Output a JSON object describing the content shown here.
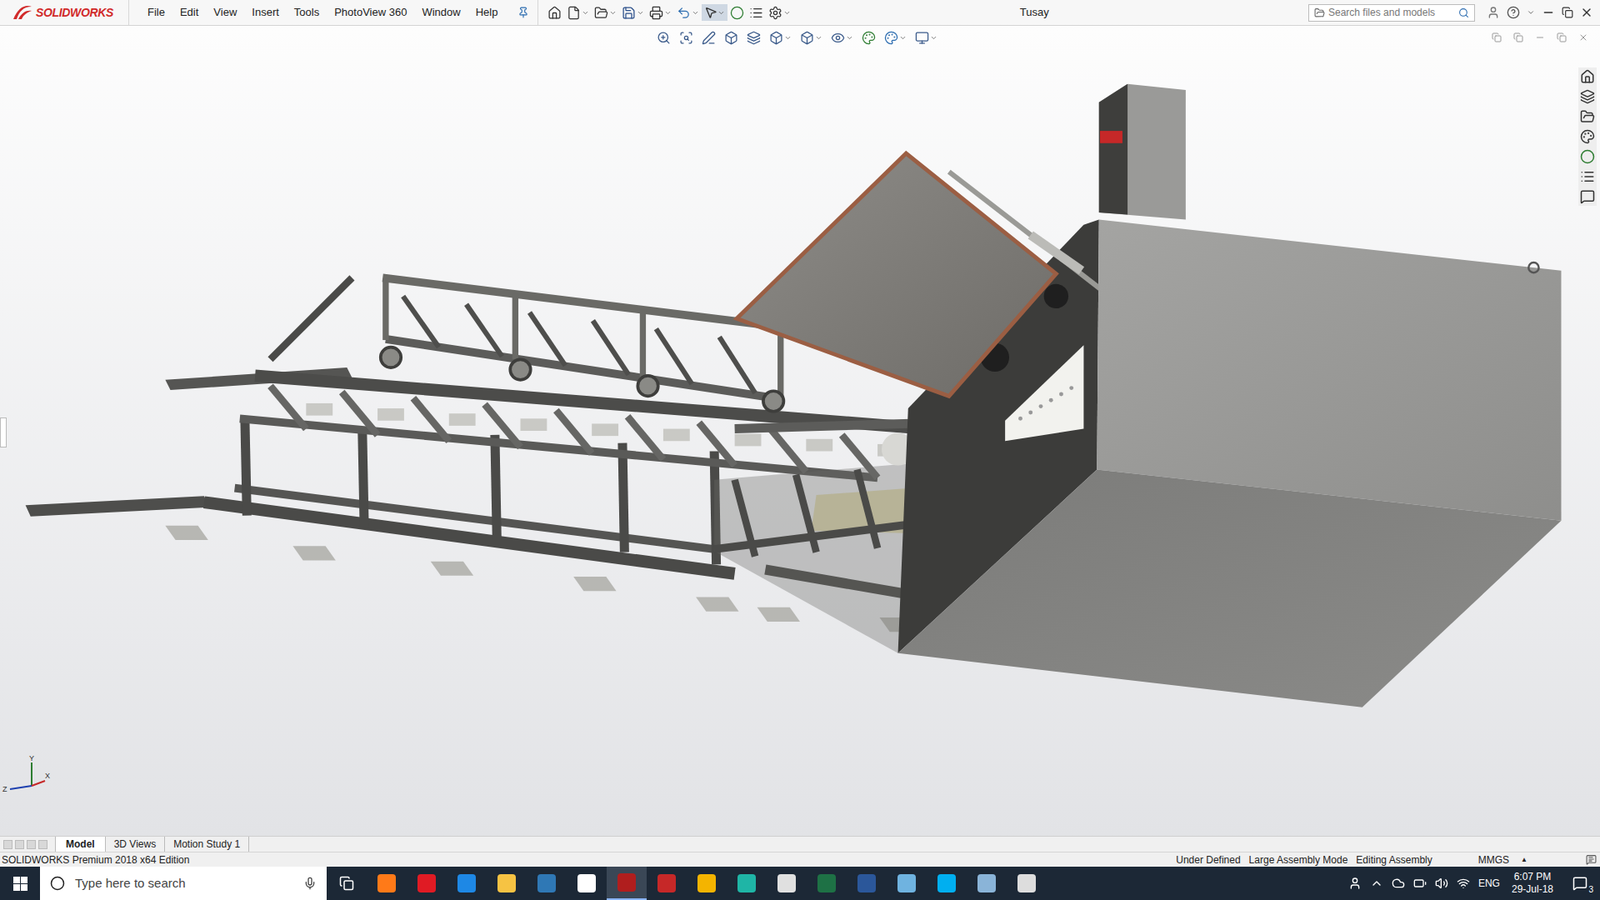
{
  "app": {
    "logo_text": "SOLIDWORKS",
    "window_title": "Tusay"
  },
  "menus": [
    "File",
    "Edit",
    "View",
    "Insert",
    "Tools",
    "PhotoView 360",
    "Window",
    "Help"
  ],
  "search": {
    "placeholder": "Search files and models"
  },
  "triad": {
    "labels": [
      "Y",
      "Z",
      "X"
    ]
  },
  "model_tabs": [
    {
      "label": "Model",
      "selected": true
    },
    {
      "label": "3D Views",
      "selected": false
    },
    {
      "label": "Motion Study 1",
      "selected": false
    }
  ],
  "status_bar": {
    "edition": "SOLIDWORKS Premium 2018 x64 Edition",
    "items": [
      "Under Defined",
      "Large Assembly Mode",
      "Editing Assembly"
    ],
    "units": "MMGS",
    "units_arrow": "▲"
  },
  "taskbar": {
    "search_placeholder": "Type here to search",
    "language": "ENG",
    "time": "6:07 PM",
    "date": "29-Jul-18",
    "notifications": "3"
  }
}
